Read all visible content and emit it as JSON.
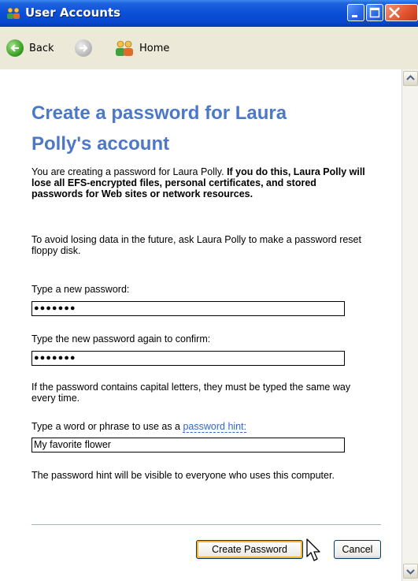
{
  "window": {
    "title": "User Accounts"
  },
  "nav": {
    "back_label": "Back",
    "home_label": "Home"
  },
  "main": {
    "heading_line1": "Create a password for Laura",
    "heading_line2": "Polly's account",
    "warning_intro": "You are creating a password for Laura Polly. ",
    "warning_bold": "If you do this, Laura Polly will lose all EFS-encrypted files, personal certificates, and stored passwords for Web sites or network resources.",
    "avoid_text": "To avoid losing data in the future, ask Laura Polly to make a password reset floppy disk.",
    "new_password_label": "Type a new password:",
    "new_password_value": "●●●●●●●",
    "confirm_password_label": "Type the new password again to confirm:",
    "confirm_password_value": "●●●●●●●",
    "capital_note": "If the password contains capital letters, they must be typed the same way every time.",
    "hint_label_prefix": "Type a word or phrase to use as a ",
    "hint_link": "password hint:",
    "hint_value": "My favorite flower",
    "hint_note": "The password hint will be visible to everyone who uses this computer."
  },
  "buttons": {
    "create": "Create Password",
    "cancel": "Cancel"
  },
  "colors": {
    "title_bar": "#0A4FD8",
    "heading": "#4D78C8",
    "link": "#3366CC",
    "background": "#ECE9D8"
  },
  "icons": [
    "users-icon",
    "minimize-icon",
    "maximize-icon",
    "close-icon",
    "back-arrow-icon",
    "forward-arrow-icon",
    "home-users-icon",
    "scroll-up-icon",
    "scroll-down-icon",
    "mouse-cursor-icon"
  ]
}
